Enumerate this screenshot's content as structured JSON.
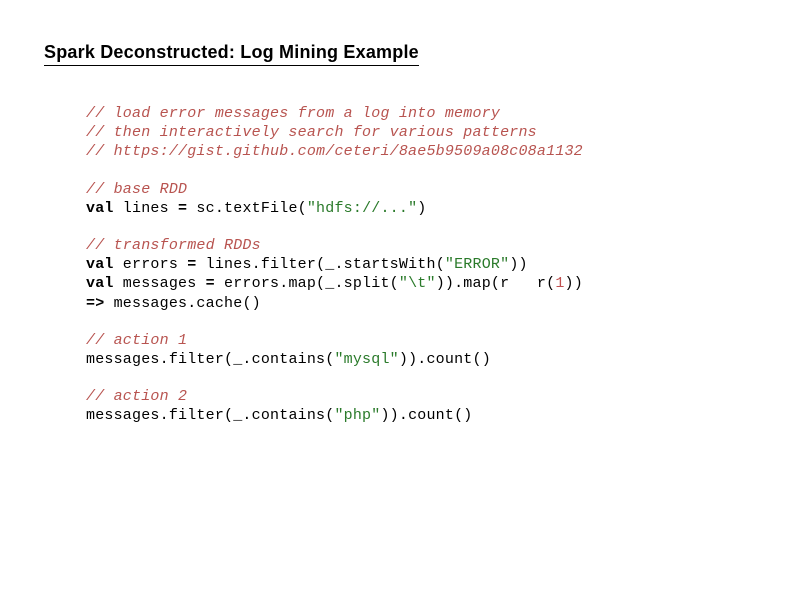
{
  "title": {
    "part1": "Spark Deconstructed:",
    "part2": " Log Mining Example"
  },
  "code": {
    "c1": "// load error messages from a log into memory",
    "c2": "// then interactively search for various patterns",
    "c3": "// https://gist.github.com/ceteri/8ae5b9509a08c08a1132",
    "c4": "// base RDD",
    "l5a": "val",
    "l5b": " lines ",
    "l5c": "=",
    "l5d": " sc.textFile",
    "l5e": "(",
    "l5f": "\"hdfs://...\"",
    "l5g": ")",
    "c6": "// transformed RDDs",
    "l7a": "val",
    "l7b": " errors ",
    "l7c": "=",
    "l7d": " lines.filter",
    "l7e": "(",
    "l7f": "_.startsWith",
    "l7g": "(",
    "l7h": "\"ERROR\"",
    "l7i": "))",
    "l8a": "val",
    "l8b": " messages ",
    "l8c": "=",
    "l8d": " errors.map",
    "l8e": "(",
    "l8f": "_.split",
    "l8g": "(",
    "l8h": "\"\\t\"",
    "l8i": ")).",
    "l8j": "map",
    "l8k": "(",
    "l8l": "r   r",
    "l8m": "(",
    "l8n": "1",
    "l8o": "))",
    "l9a": "=>",
    "l9b": " messages.cache",
    "l9c": "()",
    "c10": "// action 1",
    "l11a": "messages.filter",
    "l11b": "(",
    "l11c": "_.contains",
    "l11d": "(",
    "l11e": "\"mysql\"",
    "l11f": ")).",
    "l11g": "count",
    "l11h": "()",
    "c12": "// action 2",
    "l13a": "messages.filter",
    "l13b": "(",
    "l13c": "_.contains",
    "l13d": "(",
    "l13e": "\"php\"",
    "l13f": ")).",
    "l13g": "count",
    "l13h": "()"
  }
}
